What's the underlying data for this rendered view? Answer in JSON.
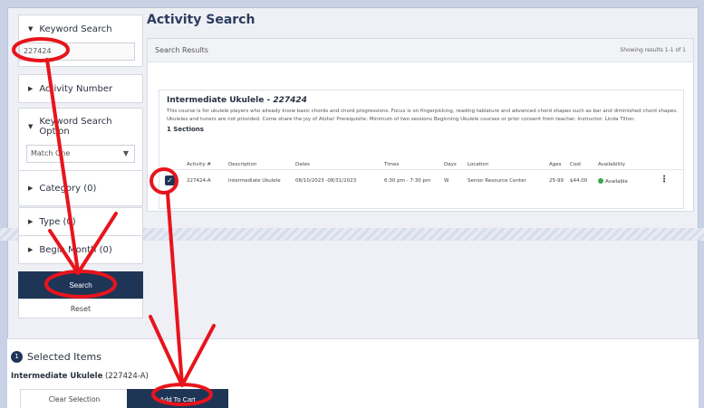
{
  "page": {
    "title": "Activity Search"
  },
  "sidebar": {
    "keyword_search": {
      "label": "Keyword Search",
      "value": "227424"
    },
    "activity_number": {
      "label": "Activity Number"
    },
    "keyword_option": {
      "label": "Keyword Search Option",
      "selected": "Match One"
    },
    "category": {
      "label": "Category (0)"
    },
    "type": {
      "label": "Type (0)"
    },
    "begin_month": {
      "label": "Begin Month (0)"
    },
    "search_label": "Search",
    "reset_label": "Reset"
  },
  "results": {
    "header": "Search Results",
    "count": "Showing results 1-1 of 1",
    "course": {
      "name": "Intermediate Ukulele",
      "separator": " - ",
      "id": "227424",
      "description": "This course is for ukulele players who already know basic chords and chord progressions. Focus is on fingerpicking, reading tablature and advanced chord shapes such as bar and diminished chord shapes. Ukuleles and tuners are not provided. Come share the joy of Aloha! Prerequisite: Minimum of two sessions Beginning Ukulele courses or prior consent from teacher. Instructor: Linda Tilton.",
      "sections_label": "1 Sections"
    },
    "columns": [
      "Activity #",
      "Description",
      "Dates",
      "Times",
      "Days",
      "Location",
      "Ages",
      "Cost",
      "Availability"
    ],
    "rows": [
      {
        "activity": "227424-A",
        "description": "Intermediate Ukulele",
        "dates": "08/10/2023 -08/31/2023",
        "times": "6:30 pm - 7:30 pm",
        "days": "W",
        "location": "Senior Resource Center",
        "ages": "25-99",
        "cost": "$44.00",
        "availability": "Available"
      }
    ]
  },
  "selected": {
    "count": "1",
    "title": "Selected Items",
    "item_name": "Intermediate Ukulele",
    "item_code": "(227424-A)",
    "clear_label": "Clear Selection",
    "cart_label": "Add To Cart"
  },
  "colors": {
    "accent": "#1e3556",
    "annotation": "#e8141c",
    "available": "#3fa54a"
  }
}
